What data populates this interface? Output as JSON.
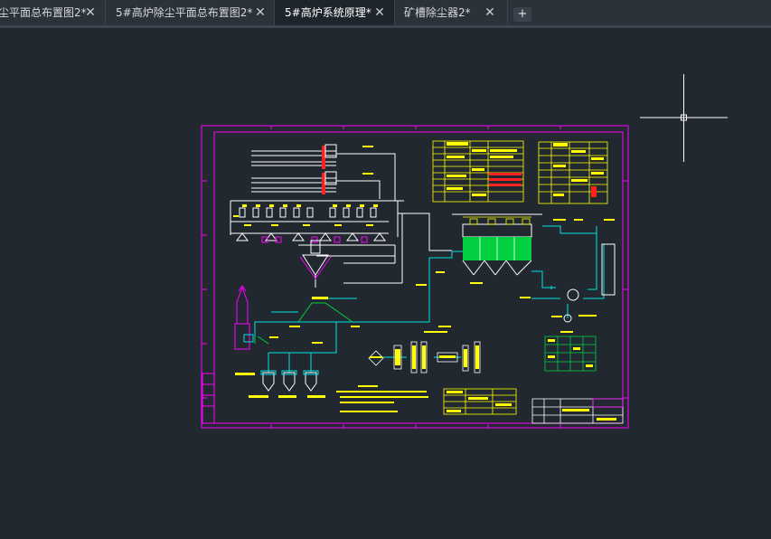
{
  "tabs": [
    {
      "label": "尘平面总布置图2*",
      "close": "✕",
      "active": false
    },
    {
      "label": "5#高炉除尘平面总布置图2*",
      "close": "✕",
      "active": false
    },
    {
      "label": "5#高炉系统原理*",
      "close": "✕",
      "active": true
    },
    {
      "label": "矿槽除尘器2*",
      "close": "✕",
      "active": false
    }
  ],
  "add_tab": "+",
  "colors": {
    "background": "#212830",
    "tabbar": "#2b323a",
    "frame": "#ff00ff",
    "schematic_white": "#ffffff",
    "schematic_yellow": "#ffff00",
    "schematic_cyan": "#00e5e5",
    "schematic_green": "#00d040",
    "schematic_red": "#ff2020"
  },
  "icons": [
    "close-icon",
    "plus-icon",
    "crosshair-cursor-icon"
  ]
}
